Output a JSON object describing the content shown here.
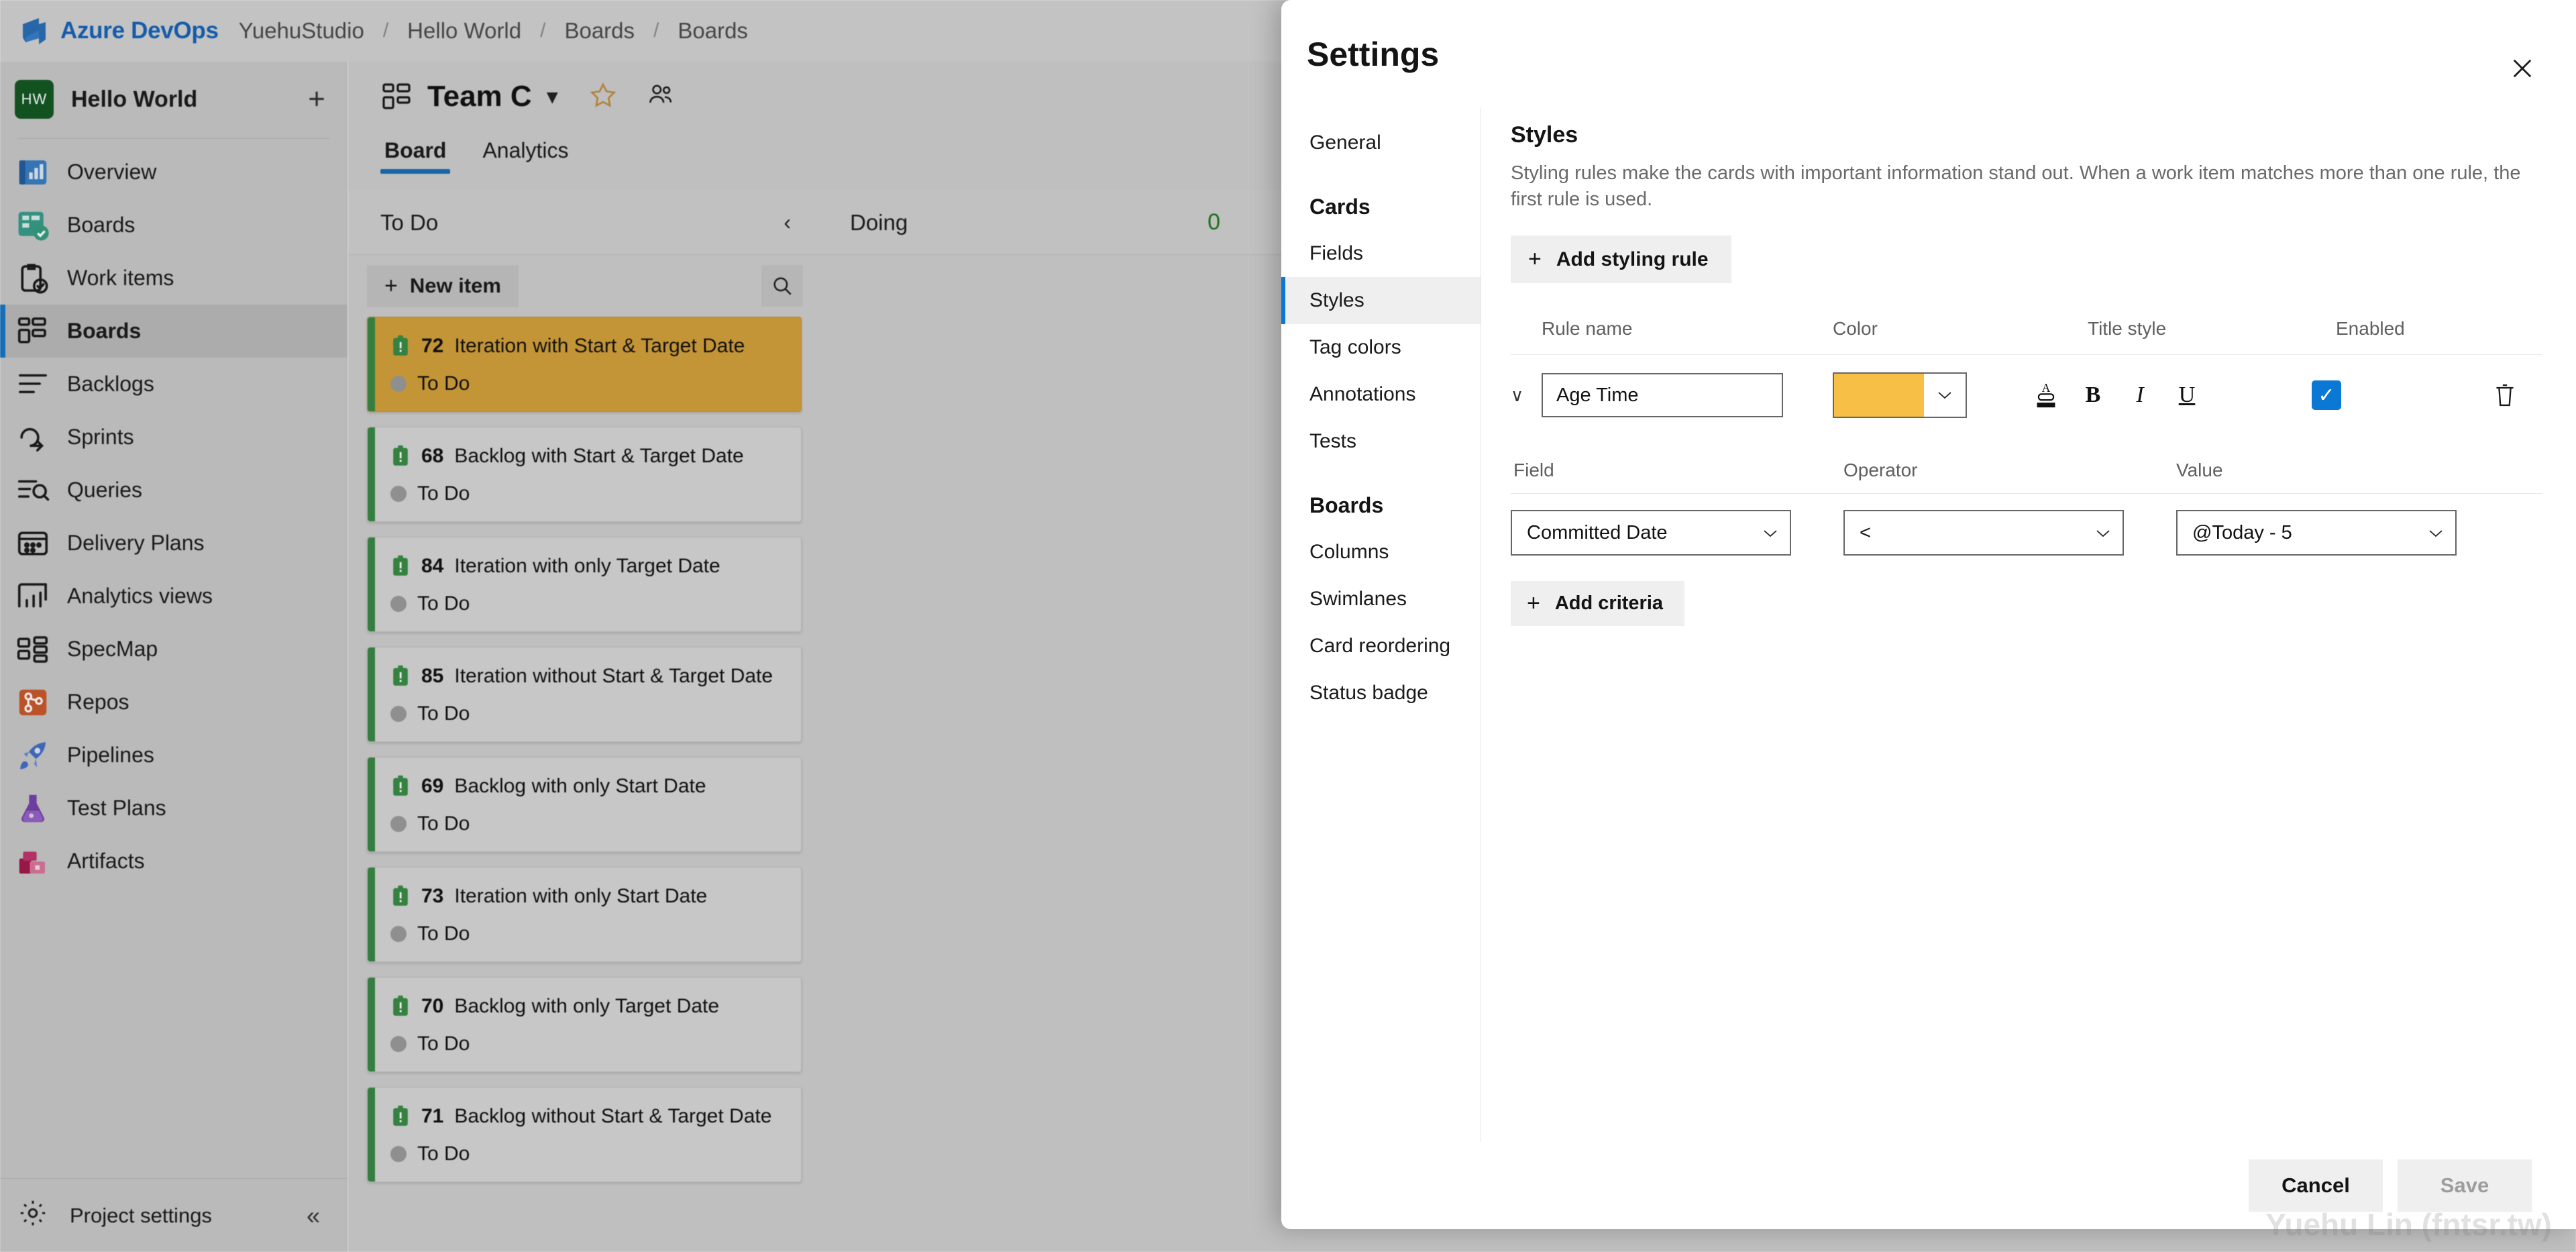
{
  "topbar": {
    "brand": "Azure DevOps",
    "breadcrumbs": [
      "YuehuStudio",
      "Hello World",
      "Boards",
      "Boards"
    ],
    "separator": "/"
  },
  "sidebar": {
    "project": {
      "initials": "HW",
      "name": "Hello World",
      "add_label": "+"
    },
    "items": [
      {
        "label": "Overview",
        "icon": "overview-icon",
        "selected": false
      },
      {
        "label": "Boards",
        "icon": "boards-icon",
        "selected": false
      },
      {
        "label": "Work items",
        "icon": "work-items-icon",
        "selected": false
      },
      {
        "label": "Boards",
        "icon": "boards-nav-icon",
        "selected": true
      },
      {
        "label": "Backlogs",
        "icon": "backlogs-icon",
        "selected": false
      },
      {
        "label": "Sprints",
        "icon": "sprints-icon",
        "selected": false
      },
      {
        "label": "Queries",
        "icon": "queries-icon",
        "selected": false
      },
      {
        "label": "Delivery Plans",
        "icon": "delivery-plans-icon",
        "selected": false
      },
      {
        "label": "Analytics views",
        "icon": "analytics-views-icon",
        "selected": false
      },
      {
        "label": "SpecMap",
        "icon": "specmap-icon",
        "selected": false
      },
      {
        "label": "Repos",
        "icon": "repos-icon",
        "selected": false
      },
      {
        "label": "Pipelines",
        "icon": "pipelines-icon",
        "selected": false
      },
      {
        "label": "Test Plans",
        "icon": "test-plans-icon",
        "selected": false
      },
      {
        "label": "Artifacts",
        "icon": "artifacts-icon",
        "selected": false
      }
    ],
    "footer": {
      "label": "Project settings",
      "collapse": "«"
    }
  },
  "board": {
    "team_name": "Team C",
    "tabs": [
      {
        "label": "Board",
        "active": true
      },
      {
        "label": "Analytics",
        "active": false
      }
    ],
    "columns": [
      {
        "title": "To Do",
        "wip": "",
        "collapse": "‹"
      },
      {
        "title": "Doing",
        "wip": "0",
        "collapse": ""
      }
    ],
    "toolbar": {
      "new_item": "New item",
      "new_item_plus": "+"
    },
    "cards": [
      {
        "id": "72",
        "title": "Iteration with Start & Target Date",
        "state": "To Do",
        "highlight": true
      },
      {
        "id": "68",
        "title": "Backlog with Start & Target Date",
        "state": "To Do",
        "highlight": false
      },
      {
        "id": "84",
        "title": "Iteration with only Target Date",
        "state": "To Do",
        "highlight": false
      },
      {
        "id": "85",
        "title": "Iteration without Start & Target Date",
        "state": "To Do",
        "highlight": false
      },
      {
        "id": "69",
        "title": "Backlog with only Start Date",
        "state": "To Do",
        "highlight": false
      },
      {
        "id": "73",
        "title": "Iteration with only Start Date",
        "state": "To Do",
        "highlight": false
      },
      {
        "id": "70",
        "title": "Backlog with only Target Date",
        "state": "To Do",
        "highlight": false
      },
      {
        "id": "71",
        "title": "Backlog without Start & Target Date",
        "state": "To Do",
        "highlight": false
      }
    ]
  },
  "dialog": {
    "title": "Settings",
    "close_label": "×",
    "nav": [
      {
        "label": "General",
        "type": "item",
        "selected": false
      },
      {
        "label": "Cards",
        "type": "group"
      },
      {
        "label": "Fields",
        "type": "item",
        "selected": false
      },
      {
        "label": "Styles",
        "type": "item",
        "selected": true
      },
      {
        "label": "Tag colors",
        "type": "item",
        "selected": false
      },
      {
        "label": "Annotations",
        "type": "item",
        "selected": false
      },
      {
        "label": "Tests",
        "type": "item",
        "selected": false
      },
      {
        "label": "Boards",
        "type": "group"
      },
      {
        "label": "Columns",
        "type": "item",
        "selected": false
      },
      {
        "label": "Swimlanes",
        "type": "item",
        "selected": false
      },
      {
        "label": "Card reordering",
        "type": "item",
        "selected": false
      },
      {
        "label": "Status badge",
        "type": "item",
        "selected": false
      }
    ],
    "styles": {
      "heading": "Styles",
      "description": "Styling rules make the cards with important information stand out. When a work item matches more than one rule, the first rule is used.",
      "add_rule_label": "Add styling rule",
      "add_rule_plus": "+",
      "grid_headers": {
        "rule_name": "Rule name",
        "color": "Color",
        "title_style": "Title style",
        "enabled": "Enabled"
      },
      "rule": {
        "expander": "∨",
        "name_value": "Age Time",
        "name_placeholder": "Rule name",
        "color_hex": "#f7bf45",
        "color_caret": "∨",
        "title_style": {
          "font_color": "A",
          "bold": "B",
          "italic": "I",
          "underline": "U"
        },
        "enabled": true,
        "enabled_check": "✓",
        "delete_label": "Delete"
      },
      "criteria_headers": {
        "field": "Field",
        "operator": "Operator",
        "value": "Value"
      },
      "criteria": {
        "field": "Committed Date",
        "operator": "<",
        "value": "@Today - 5",
        "caret": "∨"
      },
      "add_criteria_label": "Add criteria",
      "add_criteria_plus": "+"
    },
    "footer": {
      "cancel": "Cancel",
      "save": "Save"
    }
  },
  "watermark": "Yuehu Lin (fntsr.tw)",
  "colors": {
    "accent": "#0a78d4",
    "brand_blue": "#0a64c8",
    "rule_color": "#f7bf45",
    "card_highlight": "#dba028",
    "card_left_bar": "#2e8b3d",
    "wip_green": "#107c10"
  }
}
